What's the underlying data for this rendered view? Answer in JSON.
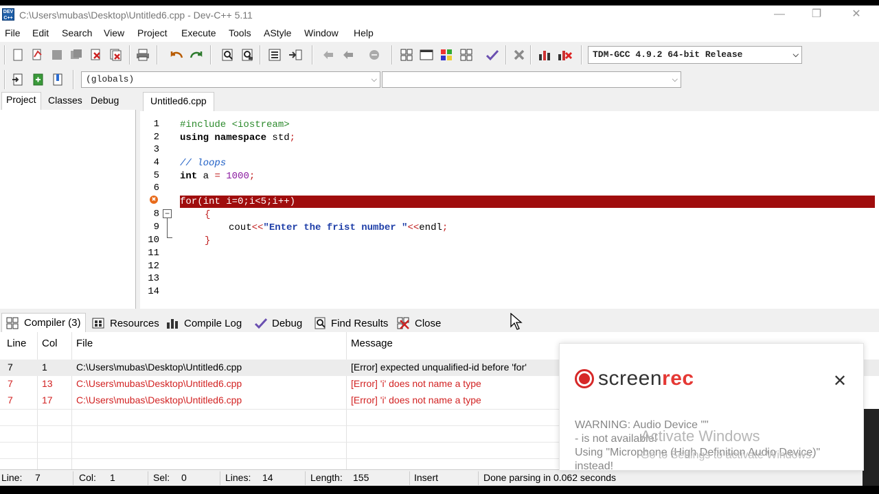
{
  "window": {
    "icon_text": "DEV C++",
    "title": "C:\\Users\\mubas\\Desktop\\Untitled6.cpp - Dev-C++ 5.11",
    "minimize_glyph": "—",
    "maximize_glyph": "❐",
    "close_glyph": "✕"
  },
  "menu": [
    "File",
    "Edit",
    "Search",
    "View",
    "Project",
    "Execute",
    "Tools",
    "AStyle",
    "Window",
    "Help"
  ],
  "toolbar": {
    "compiler_select": "TDM-GCC 4.9.2 64-bit Release",
    "scope_select": "(globals)",
    "function_select": ""
  },
  "left_panel": {
    "tabs": [
      "Project",
      "Classes",
      "Debug"
    ]
  },
  "editor": {
    "file_tab": "Untitled6.cpp",
    "line_numbers": [
      "1",
      "2",
      "3",
      "4",
      "5",
      "6",
      "",
      "8",
      "9",
      "10",
      "11",
      "12",
      "13",
      "14"
    ],
    "fold_glyph": "−",
    "error_marker_glyph": "✖",
    "lines": {
      "l1": "#include <iostream>",
      "l2_kw": "using namespace ",
      "l2_id": "std",
      "l2_semi": ";",
      "l4": "// loops",
      "l5_kw": "int",
      "l5_a": " a ",
      "l5_eq": "=",
      "l5_num": " 1000",
      "l5_semi": ";",
      "l7": "for(int i=0;i<5;i++)",
      "l8": "{",
      "l9_id": "cout",
      "l9_op": "<<",
      "l9_str": "\"Enter the frist number \"",
      "l9_op2": "<<",
      "l9_end": "endl",
      "l9_semi": ";",
      "l10": "}"
    }
  },
  "bottom_tabs": {
    "compiler": "Compiler (3)",
    "resources": "Resources",
    "compile_log": "Compile Log",
    "debug": "Debug",
    "find_results": "Find Results",
    "close": "Close"
  },
  "results": {
    "headers": {
      "line": "Line",
      "col": "Col",
      "file": "File",
      "message": "Message"
    },
    "rows": [
      {
        "line": "7",
        "col": "1",
        "file": "C:\\Users\\mubas\\Desktop\\Untitled6.cpp",
        "message": "[Error] expected unqualified-id before 'for'"
      },
      {
        "line": "7",
        "col": "13",
        "file": "C:\\Users\\mubas\\Desktop\\Untitled6.cpp",
        "message": "[Error] 'i' does not name a type"
      },
      {
        "line": "7",
        "col": "17",
        "file": "C:\\Users\\mubas\\Desktop\\Untitled6.cpp",
        "message": "[Error] 'i' does not name a type"
      }
    ]
  },
  "status": {
    "line_label": "Line:",
    "line_value": "7",
    "col_label": "Col:",
    "col_value": "1",
    "sel_label": "Sel:",
    "sel_value": "0",
    "lines_label": "Lines:",
    "lines_value": "14",
    "length_label": "Length:",
    "length_value": "155",
    "mode": "Insert",
    "message": "Done parsing in 0.062 seconds"
  },
  "toast": {
    "brand_light": "screen",
    "brand_bold": "rec",
    "close_glyph": "✕",
    "warning_1": "WARNING: Audio Device \"\"",
    "warning_2": "- is not available!",
    "warning_3": "Using \"Microphone (High Definition Audio Device)\"",
    "warning_4": "instead!",
    "activate_title": "Activate Windows",
    "activate_sub": "Go to Settings to activate Windows."
  },
  "colors": {
    "error_line_bg": "#a00d0d",
    "error_text": "#d22222",
    "brand_red": "#e53935"
  }
}
